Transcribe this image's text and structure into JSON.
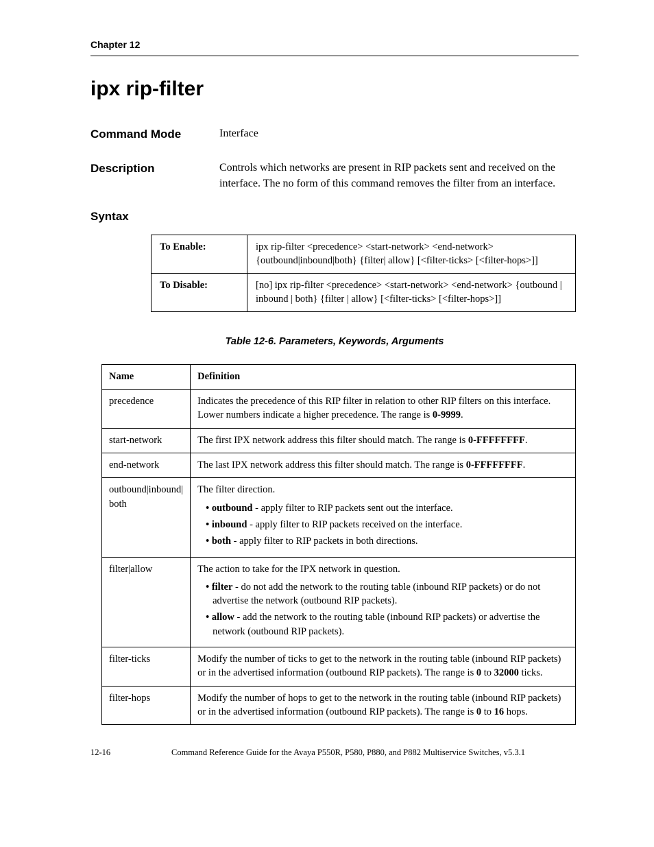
{
  "header": {
    "chapter": "Chapter 12"
  },
  "title": "ipx rip-filter",
  "commandMode": {
    "label": "Command Mode",
    "value": "Interface"
  },
  "description": {
    "label": "Description",
    "value": "Controls which networks are present in RIP packets sent and received on the interface. The no form of this command removes the filter from an interface."
  },
  "syntax": {
    "label": "Syntax",
    "enableLabel": "To Enable:",
    "enableText": "ipx rip-filter <precedence> <start-network> <end-network> {outbound|inbound|both} {filter| allow} [<filter-ticks> [<filter-hops>]]",
    "disableLabel": "To Disable:",
    "disableText": "[no] ipx rip-filter <precedence> <start-network> <end-network> {outbound | inbound | both} {filter | allow} [<filter-ticks> [<filter-hops>]]"
  },
  "paramTable": {
    "caption": "Table 12-6.  Parameters, Keywords, Arguments",
    "headName": "Name",
    "headDef": "Definition",
    "rows": {
      "precedence": {
        "name": "precedence",
        "deft1": "Indicates the precedence of this RIP filter in relation to other RIP filters on this interface. Lower numbers indicate a higher precedence. The range is ",
        "defb1": "0-9999",
        "deft2": "."
      },
      "startNetwork": {
        "name": "start-network",
        "deft1": "The first IPX network address this filter should match. The range is ",
        "defb1": "0-FFFFFFFF",
        "deft2": "."
      },
      "endNetwork": {
        "name": "end-network",
        "deft1": "The last IPX network address this filter should match. The range is ",
        "defb1": "0-FFFFFFFF",
        "deft2": "."
      },
      "direction": {
        "name": "outbound|inbound| both",
        "intro": "The filter direction.",
        "b1bold": "outbound",
        "b1text": " - apply filter to RIP packets sent out the interface.",
        "b2bold": "inbound",
        "b2text": " - apply filter to RIP packets received on the interface.",
        "b3bold": "both",
        "b3text": " - apply filter to RIP packets in both directions."
      },
      "action": {
        "name": "filter|allow",
        "intro": "The action to take for the IPX network in question.",
        "b1bold": "filter",
        "b1text": " - do not add the network to the routing table (inbound RIP packets) or do not advertise the network (outbound RIP packets).",
        "b2bold": "allow",
        "b2text": " - add the network to the routing table (inbound RIP packets) or advertise the network (outbound RIP packets)."
      },
      "filterTicks": {
        "name": "filter-ticks",
        "t1": "Modify the number of ticks to get to the network in the routing table (inbound RIP packets) or in the advertised information (outbound RIP packets). The range is ",
        "b1": "0",
        "t2": " to ",
        "b2": "32000",
        "t3": " ticks."
      },
      "filterHops": {
        "name": "filter-hops",
        "t1": "Modify the number of hops to get to the network in the routing table (inbound RIP packets) or in the advertised information (outbound RIP packets). The range is ",
        "b1": "0",
        "t2": " to ",
        "b2": "16",
        "t3": " hops."
      }
    }
  },
  "footer": {
    "pageNumber": "12-16",
    "text": "Command Reference Guide for the Avaya P550R, P580, P880, and P882 Multiservice Switches, v5.3.1"
  }
}
